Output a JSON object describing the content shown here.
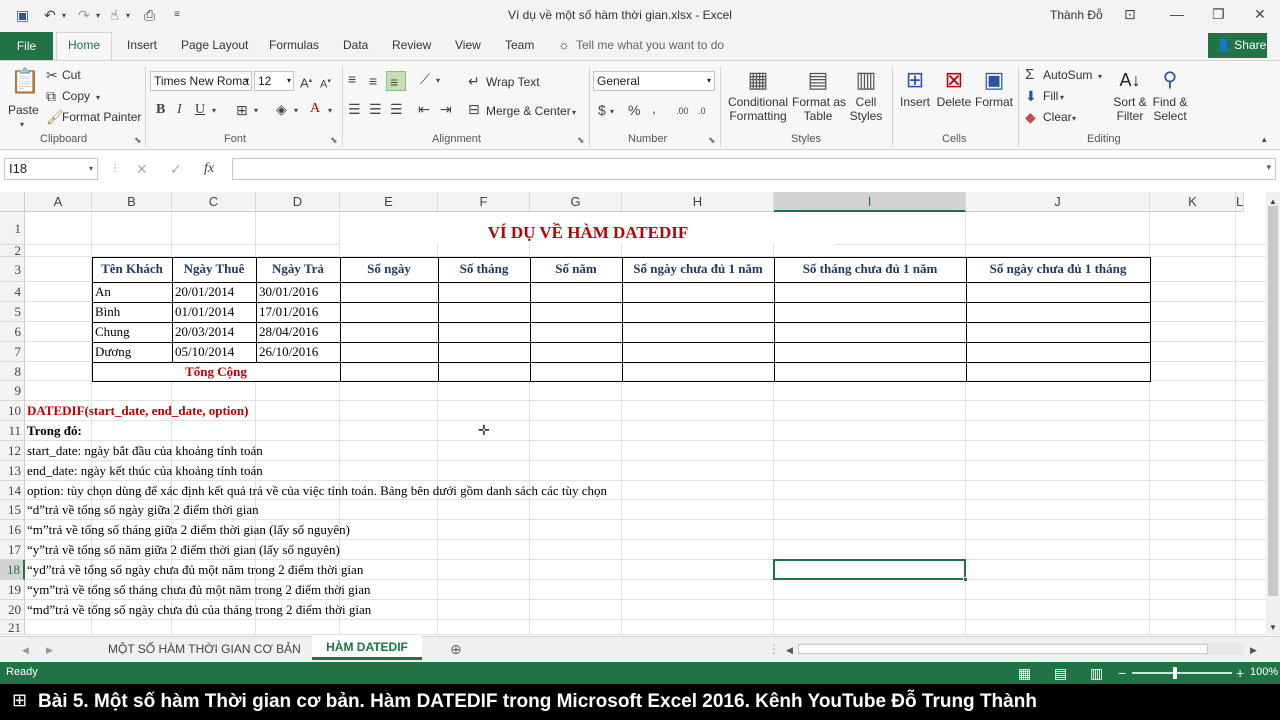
{
  "window": {
    "title": "Ví dụ về một số hàm thời gian.xlsx - Excel",
    "user": "Thành Đỗ"
  },
  "ribbon_tabs": [
    "File",
    "Home",
    "Insert",
    "Page Layout",
    "Formulas",
    "Data",
    "Review",
    "View",
    "Team"
  ],
  "tell_me": "Tell me what you want to do",
  "share": "Share",
  "clipboard": {
    "paste": "Paste",
    "cut": "Cut",
    "copy": "Copy",
    "format_painter": "Format Painter",
    "label": "Clipboard"
  },
  "font": {
    "name": "Times New Roma",
    "size": "12",
    "label": "Font"
  },
  "alignment": {
    "wrap": "Wrap Text",
    "merge": "Merge & Center",
    "label": "Alignment"
  },
  "number": {
    "format": "General",
    "label": "Number"
  },
  "styles": {
    "conditional_1": "Conditional",
    "conditional_2": "Formatting",
    "table_1": "Format as",
    "table_2": "Table",
    "cell_1": "Cell",
    "cell_2": "Styles",
    "label": "Styles"
  },
  "cells": {
    "insert": "Insert",
    "delete": "Delete",
    "format": "Format",
    "label": "Cells"
  },
  "editing": {
    "autosum": "AutoSum",
    "fill": "Fill",
    "clear": "Clear",
    "sort_1": "Sort &",
    "sort_2": "Filter",
    "find_1": "Find &",
    "find_2": "Select",
    "label": "Editing"
  },
  "namebox": "I18",
  "fx": "fx",
  "columns": [
    "A",
    "B",
    "C",
    "D",
    "E",
    "F",
    "G",
    "H",
    "I",
    "J",
    "K",
    "L"
  ],
  "rows": [
    "1",
    "2",
    "3",
    "4",
    "5",
    "6",
    "7",
    "8",
    "9",
    "10",
    "11",
    "12",
    "13",
    "14",
    "15",
    "16",
    "17",
    "18",
    "19",
    "20",
    "21"
  ],
  "sheet": {
    "title": "VÍ DỤ VỀ HÀM DATEDIF",
    "headers": [
      "Tên Khách",
      "Ngày Thuê",
      "Ngày Trả",
      "Số ngày",
      "Số tháng",
      "Số năm",
      "Số ngày chưa đủ 1 năm",
      "Số tháng chưa đủ 1 năm",
      "Số ngày chưa đủ 1 tháng"
    ],
    "data": [
      [
        "An",
        "20/01/2014",
        "30/01/2016"
      ],
      [
        "Bình",
        "01/01/2014",
        "17/01/2016"
      ],
      [
        "Chung",
        "20/03/2014",
        "28/04/2016"
      ],
      [
        "Dương",
        "05/10/2014",
        "26/10/2016"
      ]
    ],
    "total": "Tổng Cộng",
    "notes": [
      "DATEDIF(start_date, end_date, option)",
      "Trong đó:",
      "start_date: ngày bắt đầu của khoảng tính toán",
      "end_date: ngày kết thúc của khoảng tính toán",
      "option: tùy chọn dùng để xác định kết quả trả về của việc tính toán. Bảng bên dưới gồm danh sách các tùy chọn",
      "“d”trả về tổng số ngày giữa 2 điểm thời gian",
      "“m”trả về tổng số tháng giữa 2 điểm thời gian (lấy số nguyên)",
      "“y”trả về tổng số năm giữa 2 điểm thời gian (lấy số nguyên)",
      "“yd”trả về tổng số ngày chưa đủ một năm trong 2 điểm thời gian",
      "“ym”trả về tổng số tháng chưa đủ một năm trong 2 điểm thời gian",
      "“md”trả về tổng số ngày chưa đủ của tháng trong 2 điểm thời gian"
    ]
  },
  "sheet_tabs": [
    "MỘT SỐ HÀM THỜI GIAN CƠ BẢN",
    "HÀM DATEDIF"
  ],
  "status": {
    "ready": "Ready",
    "zoom": "100%"
  },
  "caption": "Bài 5. Một số hàm Thời gian cơ bản. Hàm DATEDIF trong Microsoft Excel 2016. Kênh YouTube Đỗ Trung Thành",
  "colors": {
    "excel_green": "#217346",
    "title_red": "#c00000",
    "header_blue": "#1f3864"
  }
}
